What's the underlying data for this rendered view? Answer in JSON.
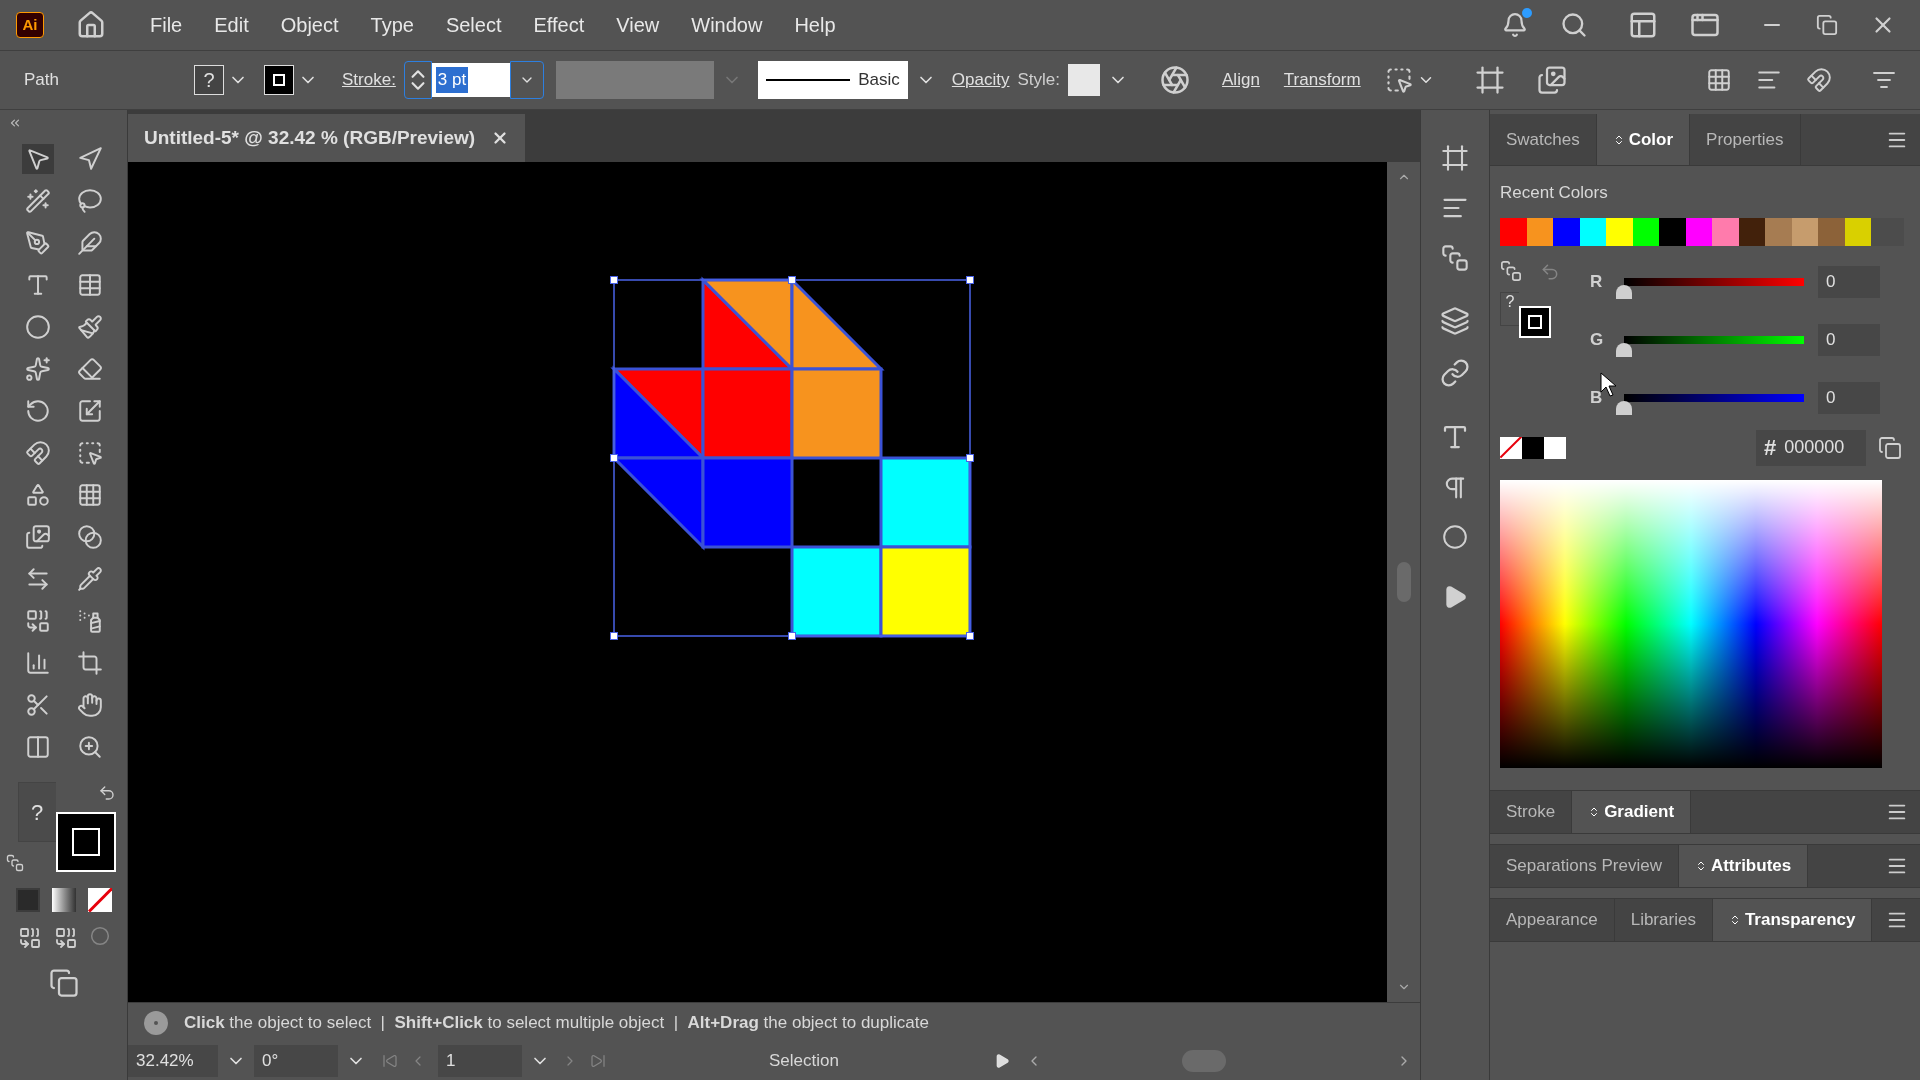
{
  "app_logo": "Ai",
  "menu": [
    "File",
    "Edit",
    "Object",
    "Type",
    "Select",
    "Effect",
    "View",
    "Window",
    "Help"
  ],
  "control_bar": {
    "selection_type": "Path",
    "fill_indicator": "?",
    "stroke_label": "Stroke:",
    "stroke_weight": "3 pt",
    "brush": "Basic",
    "opacity_label": "Opacity",
    "style_label": "Style:",
    "links": [
      "Align",
      "Transform"
    ]
  },
  "document_tab": {
    "title": "Untitled-5* @ 32.42 % (RGB/Preview)"
  },
  "toolbox": {
    "fill_indicator": "?"
  },
  "color_panel": {
    "tabs": [
      {
        "label": "Swatches",
        "selected": false
      },
      {
        "label": "Color",
        "selected": true
      },
      {
        "label": "Properties",
        "selected": false
      }
    ],
    "recent_colors_label": "Recent Colors",
    "recent_colors": [
      {
        "color": "#ff0000"
      },
      {
        "color": "#f7931e"
      },
      {
        "color": "#0000ff"
      },
      {
        "color": "#00ffff"
      },
      {
        "color": "#ffff00"
      },
      {
        "color": "#00ff00"
      },
      {
        "color": "#000000"
      },
      {
        "color": "#ff00ff"
      },
      {
        "color": "#ff7bac"
      },
      {
        "color": "#42210b"
      },
      {
        "color": "#a67c52"
      },
      {
        "color": "#c69c6d"
      },
      {
        "color": "#8c6239"
      },
      {
        "color": "#d9d000"
      }
    ],
    "fill_indicator": "?",
    "channels": [
      {
        "label": "R",
        "color": "#ff0000",
        "level": 0,
        "value": "0"
      },
      {
        "label": "G",
        "color": "#00ff00",
        "level": 0,
        "value": "0"
      },
      {
        "label": "B",
        "color": "#0000ff",
        "level": 0,
        "value": "0"
      }
    ],
    "hex_symbol": "#",
    "hex_value": "000000"
  },
  "panel_groups": [
    {
      "tabs": [
        {
          "label": "Stroke",
          "selected": false
        },
        {
          "label": "Gradient",
          "selected": true
        }
      ]
    },
    {
      "tabs": [
        {
          "label": "Separations Preview",
          "selected": false
        },
        {
          "label": "Attributes",
          "selected": true
        }
      ]
    },
    {
      "tabs": [
        {
          "label": "Appearance",
          "selected": false
        },
        {
          "label": "Libraries",
          "selected": false
        },
        {
          "label": "Transparency",
          "selected": true
        }
      ]
    }
  ],
  "status": {
    "hint": "**Click** the object to select  |  **Shift+Click** to select multiple object  |  **Alt+Drag** the object to duplicate",
    "zoom": "32.42%",
    "rotation": "0°",
    "artboard": "1",
    "tool": "Selection"
  }
}
